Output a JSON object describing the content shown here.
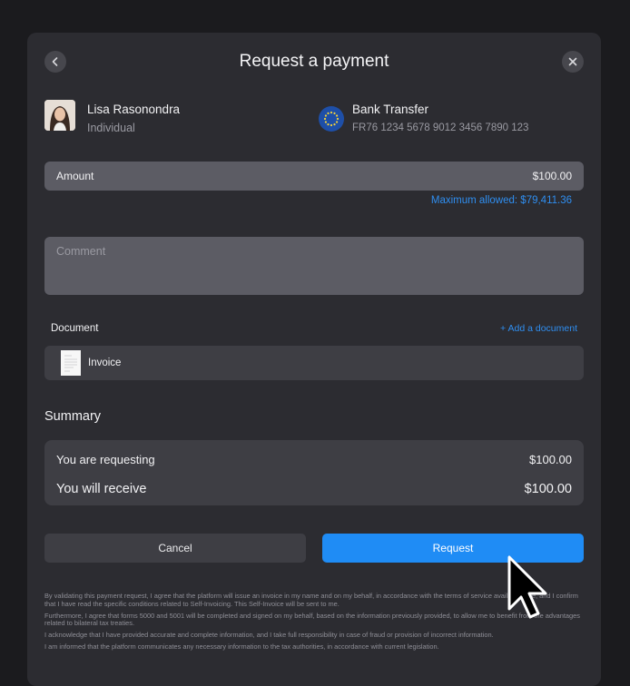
{
  "dialog": {
    "title": "Request a payment",
    "back_icon": "chevron-left-icon",
    "close_icon": "close-icon"
  },
  "recipient": {
    "name": "Lisa Rasonondra",
    "type": "Individual"
  },
  "payment_method": {
    "name": "Bank Transfer",
    "iban": "FR76 1234 5678 9012 3456 7890 123",
    "icon": "eu-flag-icon"
  },
  "amount": {
    "label": "Amount",
    "value": "$100.00",
    "max_allowed": "Maximum allowed: $79,411.36"
  },
  "comment": {
    "placeholder": "Comment"
  },
  "document": {
    "label": "Document",
    "add_label": "+ Add a document",
    "file_name": "Invoice"
  },
  "summary": {
    "title": "Summary",
    "requesting_label": "You are requesting",
    "requesting_value": "$100.00",
    "receive_label": "You will receive",
    "receive_value": "$100.00"
  },
  "actions": {
    "cancel_label": "Cancel",
    "request_label": "Request"
  },
  "legal": [
    "By validating this payment request, I agree that the platform will issue an invoice in my name and on my behalf, in accordance with the terms of service available here, and I confirm that I have read the specific conditions related to Self-Invoicing. This Self-Invoice will be sent to me.",
    "Furthermore, I agree that forms 5000 and 5001 will be completed and signed on my behalf, based on the information previously provided, to allow me to benefit from the advantages related to bilateral tax treaties.",
    "I acknowledge that I have provided accurate and complete information, and I take full responsibility in case of fraud or provision of incorrect information.",
    "I am informed that the platform communicates any necessary information to the tax authorities, in accordance with current legislation."
  ],
  "colors": {
    "accent": "#1f8cf5",
    "link": "#2f8ef0",
    "modal_bg": "#2c2c31",
    "page_bg": "#1b1b1e"
  }
}
